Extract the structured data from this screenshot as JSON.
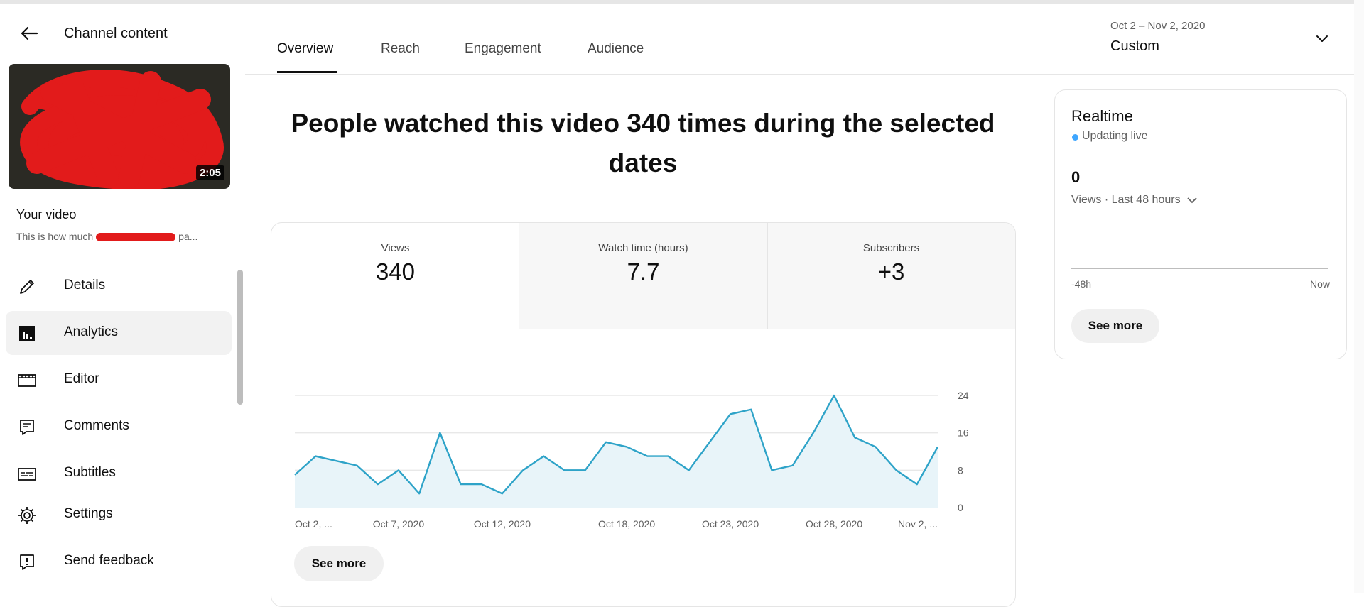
{
  "sidebar": {
    "title": "Channel content",
    "thumbnail_duration": "2:05",
    "video_label": "Your video",
    "video_description": "This is how much",
    "video_description_tail": "pa...",
    "items": [
      {
        "label": "Details",
        "icon": "pencil-icon"
      },
      {
        "label": "Analytics",
        "icon": "analytics-icon",
        "active": true
      },
      {
        "label": "Editor",
        "icon": "clapperboard-icon"
      },
      {
        "label": "Comments",
        "icon": "comment-icon"
      },
      {
        "label": "Subtitles",
        "icon": "subtitles-icon"
      }
    ],
    "bottom_items": [
      {
        "label": "Settings",
        "icon": "gear-icon"
      },
      {
        "label": "Send feedback",
        "icon": "feedback-icon"
      }
    ]
  },
  "tabs": [
    {
      "label": "Overview",
      "active": true
    },
    {
      "label": "Reach"
    },
    {
      "label": "Engagement"
    },
    {
      "label": "Audience"
    }
  ],
  "date_selector": {
    "range": "Oct 2 – Nov 2, 2020",
    "label": "Custom"
  },
  "headline": "People watched this video 340 times during the selected dates",
  "metrics": [
    {
      "label": "Views",
      "value": "340"
    },
    {
      "label": "Watch time (hours)",
      "value": "7.7"
    },
    {
      "label": "Subscribers",
      "value": "+3"
    }
  ],
  "see_more_label": "See more",
  "realtime": {
    "title": "Realtime",
    "status": "Updating live",
    "count": "0",
    "subtitle": "Views · Last 48 hours",
    "axis_start": "-48h",
    "axis_end": "Now",
    "see_more_label": "See more"
  },
  "colors": {
    "accent": "#2ea3c8",
    "fill": "#e8f4f9",
    "live_dot": "#3ea6ff"
  },
  "chart_data": {
    "type": "area",
    "x_labels": [
      "Oct 2, ...",
      "Oct 7, 2020",
      "Oct 12, 2020",
      "Oct 18, 2020",
      "Oct 23, 2020",
      "Oct 28, 2020",
      "Nov 2, ..."
    ],
    "x": [
      "2020-10-02",
      "2020-10-03",
      "2020-10-04",
      "2020-10-05",
      "2020-10-06",
      "2020-10-07",
      "2020-10-08",
      "2020-10-09",
      "2020-10-10",
      "2020-10-11",
      "2020-10-12",
      "2020-10-13",
      "2020-10-14",
      "2020-10-15",
      "2020-10-16",
      "2020-10-17",
      "2020-10-18",
      "2020-10-19",
      "2020-10-20",
      "2020-10-21",
      "2020-10-22",
      "2020-10-23",
      "2020-10-24",
      "2020-10-25",
      "2020-10-26",
      "2020-10-27",
      "2020-10-28",
      "2020-10-29",
      "2020-10-30",
      "2020-10-31",
      "2020-11-01",
      "2020-11-02"
    ],
    "series": [
      {
        "values": [
          7,
          11,
          10,
          9,
          5,
          8,
          3,
          16,
          5,
          5,
          3,
          8,
          11,
          8,
          8,
          14,
          13,
          11,
          11,
          8,
          14,
          20,
          21,
          8,
          9,
          16,
          24,
          15,
          13,
          8,
          5,
          13
        ]
      }
    ],
    "y_ticks": [
      0,
      8,
      16,
      24
    ],
    "ylim": [
      0,
      24
    ],
    "grid": true
  }
}
